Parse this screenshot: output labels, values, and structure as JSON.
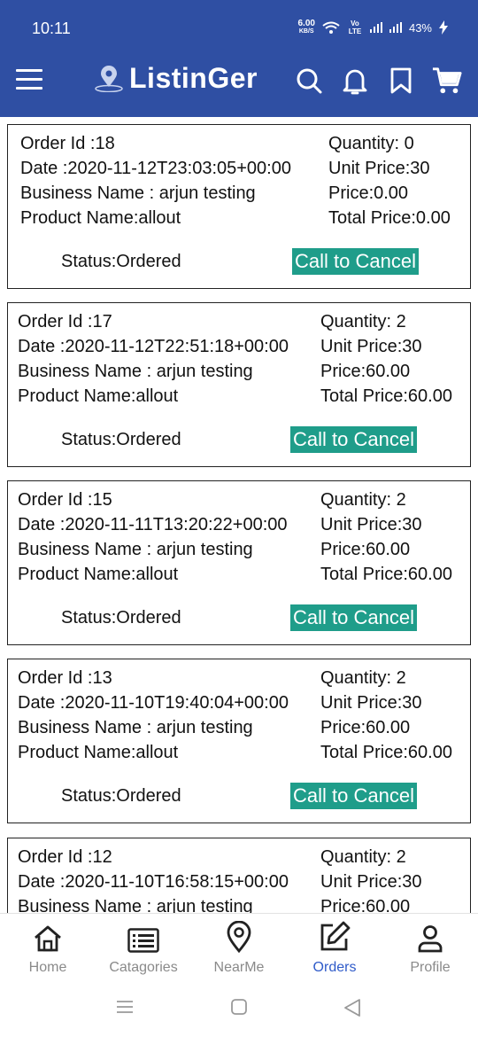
{
  "status_bar": {
    "time": "10:11",
    "speed_value": "6.00",
    "speed_unit": "KB/S",
    "network_label": "Vo LTE",
    "battery": "43%"
  },
  "app_bar": {
    "brand": "ListinGer",
    "icons": [
      "hamburger-menu-icon",
      "map-pin-icon",
      "search-icon",
      "bell-icon",
      "bookmark-icon",
      "cart-icon"
    ],
    "brand_color": "#2f4fa3"
  },
  "orders": [
    {
      "order_id": "Order Id :18",
      "date": "Date :2020-11-12T23:03:05+00:00",
      "business": "Business Name : arjun testing",
      "product": "Product Name:allout",
      "quantity": "Quantity: 0",
      "unit_price": "Unit Price:30",
      "price": "Price:0.00",
      "total": "Total Price:0.00",
      "status": "Status:Ordered",
      "cancel_label": "Call to Cancel"
    },
    {
      "order_id": "Order Id :17",
      "date": "Date :2020-11-12T22:51:18+00:00",
      "business": "Business Name : arjun testing",
      "product": "Product Name:allout",
      "quantity": "Quantity: 2",
      "unit_price": "Unit Price:30",
      "price": "Price:60.00",
      "total": "Total Price:60.00",
      "status": "Status:Ordered",
      "cancel_label": "Call to Cancel"
    },
    {
      "order_id": "Order Id :15",
      "date": "Date :2020-11-11T13:20:22+00:00",
      "business": "Business Name : arjun testing",
      "product": "Product Name:allout",
      "quantity": "Quantity: 2",
      "unit_price": "Unit Price:30",
      "price": "Price:60.00",
      "total": "Total Price:60.00",
      "status": "Status:Ordered",
      "cancel_label": "Call to Cancel"
    },
    {
      "order_id": "Order Id :13",
      "date": "Date :2020-11-10T19:40:04+00:00",
      "business": "Business Name : arjun testing",
      "product": "Product Name:allout",
      "quantity": "Quantity: 2",
      "unit_price": "Unit Price:30",
      "price": "Price:60.00",
      "total": "Total Price:60.00",
      "status": "Status:Ordered",
      "cancel_label": "Call to Cancel"
    },
    {
      "order_id": "Order Id :12",
      "date": "Date :2020-11-10T16:58:15+00:00",
      "business": "Business Name : arjun testing",
      "quantity": "Quantity: 2",
      "unit_price": "Unit Price:30",
      "price": "Price:60.00"
    }
  ],
  "tabs": [
    {
      "label": "Home",
      "icon": "home-icon"
    },
    {
      "label": "Catagories",
      "icon": "categories-icon"
    },
    {
      "label": "NearMe",
      "icon": "location-icon"
    },
    {
      "label": "Orders",
      "icon": "edit-icon",
      "active": true
    },
    {
      "label": "Profile",
      "icon": "profile-icon"
    }
  ],
  "colors": {
    "accent": "#2f5bc9",
    "cancel_button": "#1f9d8a",
    "inactive_tab": "#8a8a8a"
  }
}
